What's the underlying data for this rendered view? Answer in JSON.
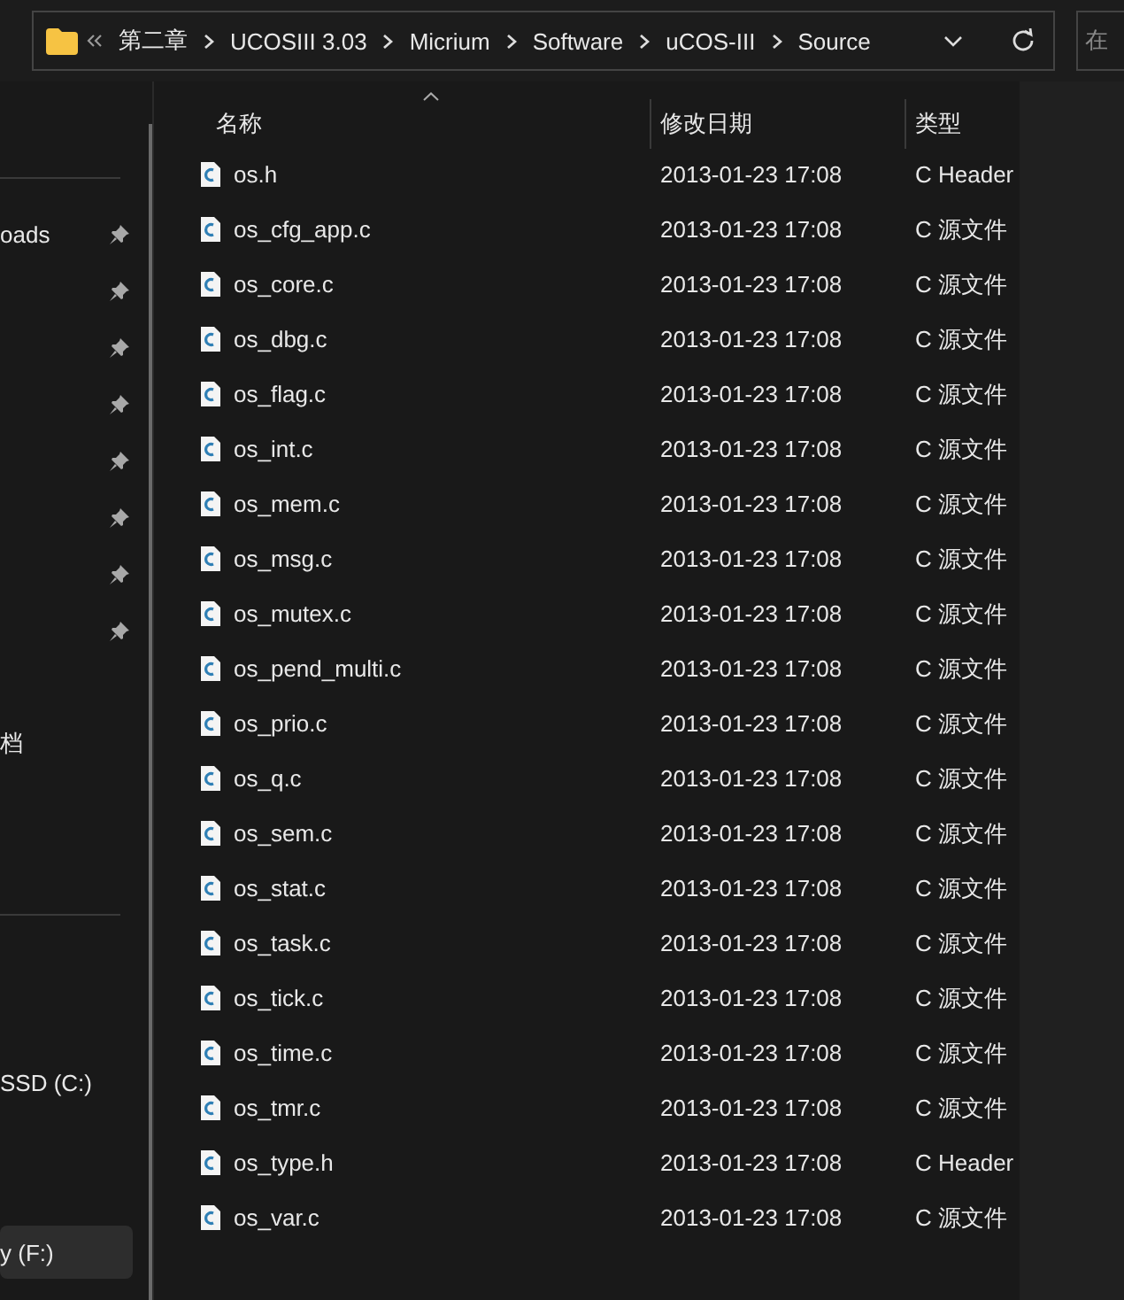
{
  "address_bar": {
    "crumbs": [
      "第二章",
      "UCOSIII 3.03",
      "Micrium",
      "Software",
      "uCOS-III",
      "Source"
    ]
  },
  "search": {
    "placeholder": "在"
  },
  "sidebar": {
    "sections": [
      {
        "items": [
          {
            "label": "oads",
            "pinned": true,
            "selected": false
          },
          {
            "pinned": true,
            "selected": false
          },
          {
            "pinned": true,
            "selected": false
          },
          {
            "pinned": true,
            "selected": false
          },
          {
            "pinned": true,
            "selected": false
          },
          {
            "pinned": true,
            "selected": false
          },
          {
            "pinned": true,
            "selected": false
          },
          {
            "pinned": true,
            "selected": false
          }
        ]
      },
      {
        "items": [
          {
            "label": "档",
            "pinned": false,
            "selected": false
          }
        ]
      },
      {
        "items": [
          {
            "label": "SSD (C:)",
            "pinned": false,
            "selected": false
          },
          {
            "label": "y (F:)",
            "pinned": false,
            "selected": true
          }
        ]
      }
    ]
  },
  "table": {
    "columns": [
      "名称",
      "修改日期",
      "类型"
    ],
    "rows": [
      {
        "name": "os.h",
        "date": "2013-01-23 17:08",
        "type": "C Header"
      },
      {
        "name": "os_cfg_app.c",
        "date": "2013-01-23 17:08",
        "type": "C 源文件"
      },
      {
        "name": "os_core.c",
        "date": "2013-01-23 17:08",
        "type": "C 源文件"
      },
      {
        "name": "os_dbg.c",
        "date": "2013-01-23 17:08",
        "type": "C 源文件"
      },
      {
        "name": "os_flag.c",
        "date": "2013-01-23 17:08",
        "type": "C 源文件"
      },
      {
        "name": "os_int.c",
        "date": "2013-01-23 17:08",
        "type": "C 源文件"
      },
      {
        "name": "os_mem.c",
        "date": "2013-01-23 17:08",
        "type": "C 源文件"
      },
      {
        "name": "os_msg.c",
        "date": "2013-01-23 17:08",
        "type": "C 源文件"
      },
      {
        "name": "os_mutex.c",
        "date": "2013-01-23 17:08",
        "type": "C 源文件"
      },
      {
        "name": "os_pend_multi.c",
        "date": "2013-01-23 17:08",
        "type": "C 源文件"
      },
      {
        "name": "os_prio.c",
        "date": "2013-01-23 17:08",
        "type": "C 源文件"
      },
      {
        "name": "os_q.c",
        "date": "2013-01-23 17:08",
        "type": "C 源文件"
      },
      {
        "name": "os_sem.c",
        "date": "2013-01-23 17:08",
        "type": "C 源文件"
      },
      {
        "name": "os_stat.c",
        "date": "2013-01-23 17:08",
        "type": "C 源文件"
      },
      {
        "name": "os_task.c",
        "date": "2013-01-23 17:08",
        "type": "C 源文件"
      },
      {
        "name": "os_tick.c",
        "date": "2013-01-23 17:08",
        "type": "C 源文件"
      },
      {
        "name": "os_time.c",
        "date": "2013-01-23 17:08",
        "type": "C 源文件"
      },
      {
        "name": "os_tmr.c",
        "date": "2013-01-23 17:08",
        "type": "C 源文件"
      },
      {
        "name": "os_type.h",
        "date": "2013-01-23 17:08",
        "type": "C Header"
      },
      {
        "name": "os_var.c",
        "date": "2013-01-23 17:08",
        "type": "C 源文件"
      }
    ]
  }
}
